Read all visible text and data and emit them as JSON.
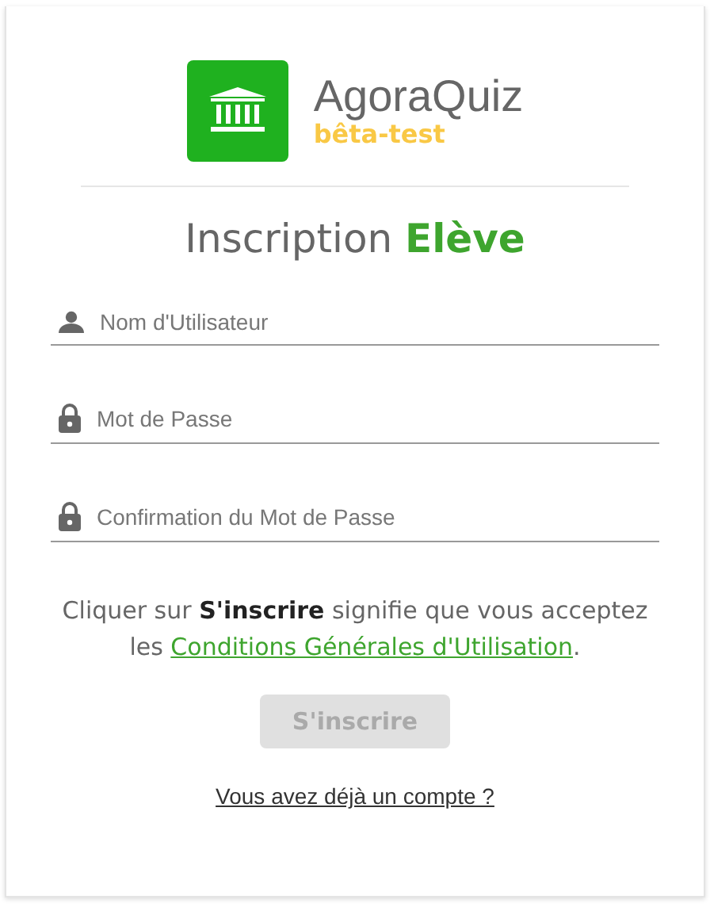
{
  "brand": {
    "name": "AgoraQuiz",
    "tag": "bêta-test"
  },
  "title": "Inscription **Elève**",
  "fields": [
    {
      "kind": "user",
      "placeholder": "Nom d'Utilisateur"
    },
    {
      "kind": "lock",
      "placeholder": "Mot de Passe"
    },
    {
      "kind": "lock",
      "placeholder": "Confirmation du Mot de Passe"
    }
  ],
  "terms": {
    "text": "Cliquer sur **S'inscrire** signifie que vous acceptez les ",
    "link": "Conditions Générales d'Utilisation",
    "after": "."
  },
  "submit": {
    "label": "S'inscrire",
    "disabled": true
  },
  "login_link": "Vous avez déjà un compte ?"
}
